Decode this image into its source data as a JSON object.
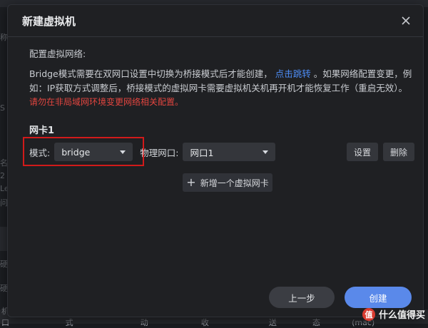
{
  "background": {
    "left_texts": [
      "称",
      "S",
      "名",
      "2",
      "Le",
      "问",
      "硬",
      "硬"
    ],
    "bottom_bar": [
      "机网口",
      "模式",
      "驱动",
      "接收",
      "发送",
      "状态",
      "物理地址(mac)"
    ]
  },
  "dialog": {
    "title": "新建虚拟机",
    "section_label": "配置虚拟网络:",
    "desc_part1": "Bridge模式需要在双网口设置中切换为桥接模式后才能创建，",
    "desc_link": "点击跳转",
    "desc_part2": "。如果网络配置变更，例如：IP获取方式调整后，桥接模式的虚拟网卡需要虚拟机关机再开机才能恢复工作（重启无效）。",
    "warning": "请勿在非局域网环境变更网络相关配置。",
    "nic_title": "网卡1",
    "mode_label": "模式:",
    "mode_value": "bridge",
    "port_label": "物理网口:",
    "port_value": "网口1",
    "settings_button": "设置",
    "delete_button": "删除",
    "add_nic_button": "新增一个虚拟网卡",
    "prev_button": "上一步",
    "create_button": "创建"
  },
  "watermark": {
    "badge": "值",
    "text": "什么值得买"
  },
  "colors": {
    "accent": "#5a89ea",
    "link": "#4d8cf5",
    "warning": "#e2453f",
    "highlight": "#d11a1a"
  }
}
